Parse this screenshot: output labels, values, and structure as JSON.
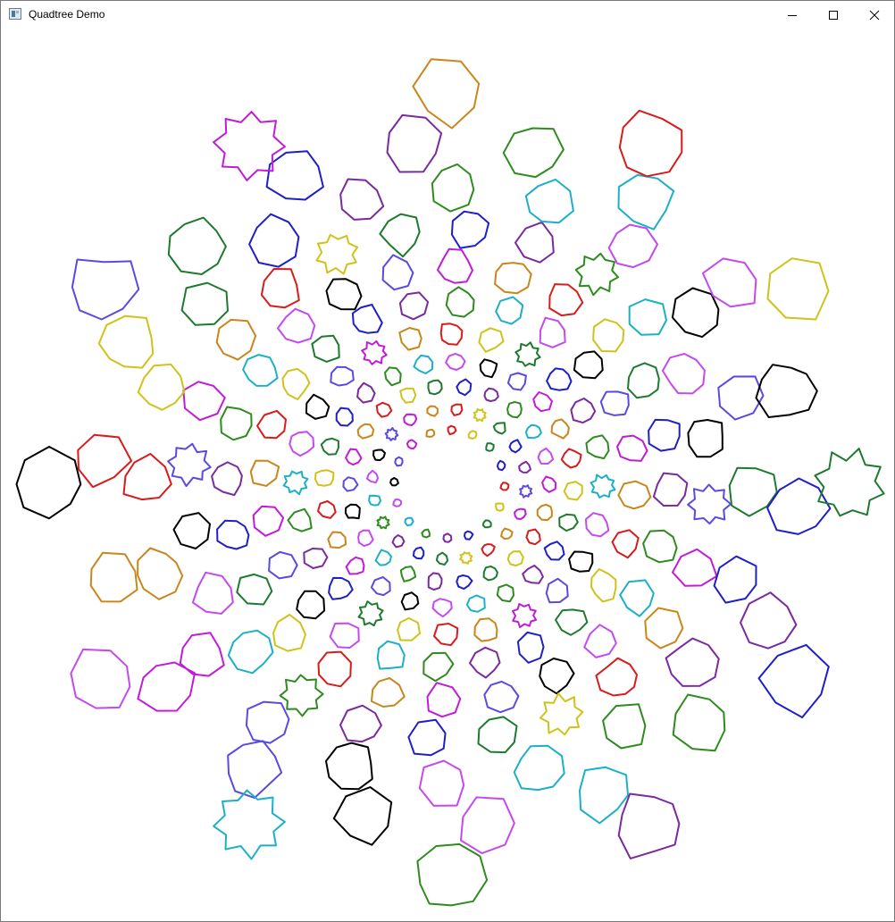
{
  "window": {
    "title": "Quadtree Demo",
    "controls": {
      "minimize": "minimize-icon",
      "maximize": "maximize-icon",
      "close": "close-icon"
    }
  },
  "canvas": {
    "background": "#ffffff",
    "stroke_palette": [
      "#d81b1b",
      "#2e8b1e",
      "#c21bd8",
      "#1f1fc8",
      "#000000",
      "#d0c21b",
      "#1bb0c8",
      "#c8861b",
      "#7a2a9e",
      "#5a4ae0",
      "#1e7a2e",
      "#c44af0"
    ]
  }
}
